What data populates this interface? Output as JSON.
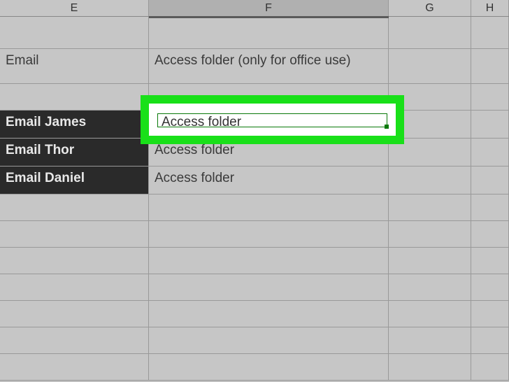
{
  "columns": {
    "E": "E",
    "F": "F",
    "G": "G",
    "H": "H"
  },
  "headerRow": {
    "E": "Email",
    "F": "Access folder (only for office use)"
  },
  "dataRows": [
    {
      "E": "Email James",
      "F": "Access folder"
    },
    {
      "E": "Email Thor",
      "F": "Access folder"
    },
    {
      "E": "Email Daniel",
      "F": "Access folder"
    }
  ],
  "selectedCell": {
    "value": "Access folder"
  }
}
